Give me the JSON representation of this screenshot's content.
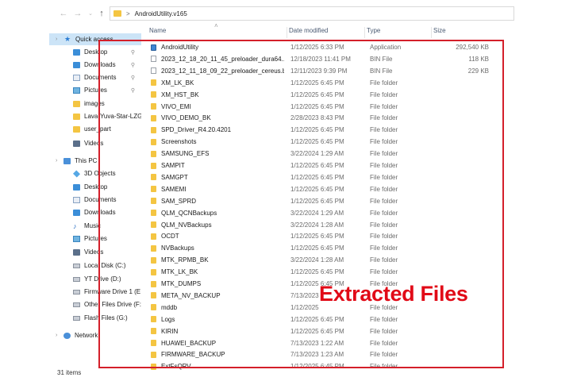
{
  "address": {
    "path": "AndroidUtility.v165",
    "separator": ">"
  },
  "nav": {
    "back": "←",
    "forward": "→",
    "up": "↑"
  },
  "columns": {
    "name": "Name",
    "date": "Date modified",
    "type": "Type",
    "size": "Size"
  },
  "sidebar": {
    "items": [
      {
        "label": "Quick access",
        "icon": "star-icon",
        "pinned": false
      },
      {
        "label": "Desktop",
        "icon": "desktop-icon",
        "pinned": true
      },
      {
        "label": "Downloads",
        "icon": "downloads-icon",
        "pinned": true
      },
      {
        "label": "Documents",
        "icon": "documents-icon",
        "pinned": true
      },
      {
        "label": "Pictures",
        "icon": "pictures-icon",
        "pinned": true
      },
      {
        "label": "images",
        "icon": "folder-icon",
        "pinned": false
      },
      {
        "label": "Lava-Yuva-Star-LZG",
        "icon": "folder-icon",
        "pinned": false
      },
      {
        "label": "user_part",
        "icon": "folder-icon",
        "pinned": false
      },
      {
        "label": "Videos",
        "icon": "videos-icon",
        "pinned": false
      },
      {
        "label": "This PC",
        "icon": "pc-icon",
        "pinned": false
      },
      {
        "label": "3D Objects",
        "icon": "3d-objects-icon",
        "pinned": false
      },
      {
        "label": "Desktop",
        "icon": "desktop-icon",
        "pinned": false
      },
      {
        "label": "Documents",
        "icon": "documents-icon",
        "pinned": false
      },
      {
        "label": "Downloads",
        "icon": "downloads-icon",
        "pinned": false
      },
      {
        "label": "Music",
        "icon": "music-icon",
        "pinned": false
      },
      {
        "label": "Pictures",
        "icon": "pictures-icon",
        "pinned": false
      },
      {
        "label": "Videos",
        "icon": "videos-icon",
        "pinned": false
      },
      {
        "label": "Local Disk (C:)",
        "icon": "drive-icon",
        "pinned": false
      },
      {
        "label": "YT Drive (D:)",
        "icon": "drive-icon",
        "pinned": false
      },
      {
        "label": "Firmware Drive 1 (E",
        "icon": "drive-icon",
        "pinned": false
      },
      {
        "label": "Other Files Drive (F:",
        "icon": "drive-icon",
        "pinned": false
      },
      {
        "label": "Flash Files (G:)",
        "icon": "drive-icon",
        "pinned": false
      },
      {
        "label": "Network",
        "icon": "network-icon",
        "pinned": false
      }
    ]
  },
  "files": [
    {
      "name": "AndroidUtility",
      "date": "1/12/2025 6:33 PM",
      "type": "Application",
      "size": "292,540 KB",
      "kind": "app"
    },
    {
      "name": "2023_12_18_20_11_45_preloader_dura64...",
      "date": "12/18/2023 11:41 PM",
      "type": "BIN File",
      "size": "118 KB",
      "kind": "file"
    },
    {
      "name": "2023_12_11_18_09_22_preloader_cereus.b...",
      "date": "12/11/2023 9:39 PM",
      "type": "BIN File",
      "size": "229 KB",
      "kind": "file"
    },
    {
      "name": "XM_LK_BK",
      "date": "1/12/2025 6:45 PM",
      "type": "File folder",
      "size": "",
      "kind": "folder"
    },
    {
      "name": "XM_HST_BK",
      "date": "1/12/2025 6:45 PM",
      "type": "File folder",
      "size": "",
      "kind": "folder"
    },
    {
      "name": "VIVO_EMI",
      "date": "1/12/2025 6:45 PM",
      "type": "File folder",
      "size": "",
      "kind": "folder"
    },
    {
      "name": "VIVO_DEMO_BK",
      "date": "2/28/2023 8:43 PM",
      "type": "File folder",
      "size": "",
      "kind": "folder"
    },
    {
      "name": "SPD_Driver_R4.20.4201",
      "date": "1/12/2025 6:45 PM",
      "type": "File folder",
      "size": "",
      "kind": "folder"
    },
    {
      "name": "Screenshots",
      "date": "1/12/2025 6:45 PM",
      "type": "File folder",
      "size": "",
      "kind": "folder"
    },
    {
      "name": "SAMSUNG_EFS",
      "date": "3/22/2024 1:29 AM",
      "type": "File folder",
      "size": "",
      "kind": "folder"
    },
    {
      "name": "SAMPIT",
      "date": "1/12/2025 6:45 PM",
      "type": "File folder",
      "size": "",
      "kind": "folder"
    },
    {
      "name": "SAMGPT",
      "date": "1/12/2025 6:45 PM",
      "type": "File folder",
      "size": "",
      "kind": "folder"
    },
    {
      "name": "SAMEMI",
      "date": "1/12/2025 6:45 PM",
      "type": "File folder",
      "size": "",
      "kind": "folder"
    },
    {
      "name": "SAM_SPRD",
      "date": "1/12/2025 6:45 PM",
      "type": "File folder",
      "size": "",
      "kind": "folder"
    },
    {
      "name": "QLM_QCNBackups",
      "date": "3/22/2024 1:29 AM",
      "type": "File folder",
      "size": "",
      "kind": "folder"
    },
    {
      "name": "QLM_NVBackups",
      "date": "3/22/2024 1:28 AM",
      "type": "File folder",
      "size": "",
      "kind": "folder"
    },
    {
      "name": "OCDT",
      "date": "1/12/2025 6:45 PM",
      "type": "File folder",
      "size": "",
      "kind": "folder"
    },
    {
      "name": "NVBackups",
      "date": "1/12/2025 6:45 PM",
      "type": "File folder",
      "size": "",
      "kind": "folder"
    },
    {
      "name": "MTK_RPMB_BK",
      "date": "3/22/2024 1:28 AM",
      "type": "File folder",
      "size": "",
      "kind": "folder"
    },
    {
      "name": "MTK_LK_BK",
      "date": "1/12/2025 6:45 PM",
      "type": "File folder",
      "size": "",
      "kind": "folder"
    },
    {
      "name": "MTK_DUMPS",
      "date": "1/12/2025 6:45 PM",
      "type": "File folder",
      "size": "",
      "kind": "folder"
    },
    {
      "name": "META_NV_BACKUP",
      "date": "7/13/2023",
      "type": "",
      "size": "",
      "kind": "folder"
    },
    {
      "name": "mddb",
      "date": "1/12/2025",
      "type": "File folder",
      "size": "",
      "kind": "folder"
    },
    {
      "name": "Logs",
      "date": "1/12/2025 6:45 PM",
      "type": "File folder",
      "size": "",
      "kind": "folder"
    },
    {
      "name": "KIRIN",
      "date": "1/12/2025 6:45 PM",
      "type": "File folder",
      "size": "",
      "kind": "folder"
    },
    {
      "name": "HUAWEI_BACKUP",
      "date": "7/13/2023 1:22 AM",
      "type": "File folder",
      "size": "",
      "kind": "folder"
    },
    {
      "name": "FIRMWARE_BACKUP",
      "date": "7/13/2023 1:23 AM",
      "type": "File folder",
      "size": "",
      "kind": "folder"
    },
    {
      "name": "ExtFsQRV",
      "date": "1/12/2025 6:45 PM",
      "type": "File folder",
      "size": "",
      "kind": "folder"
    }
  ],
  "annotation": "Extracted Files",
  "status": "31 items"
}
